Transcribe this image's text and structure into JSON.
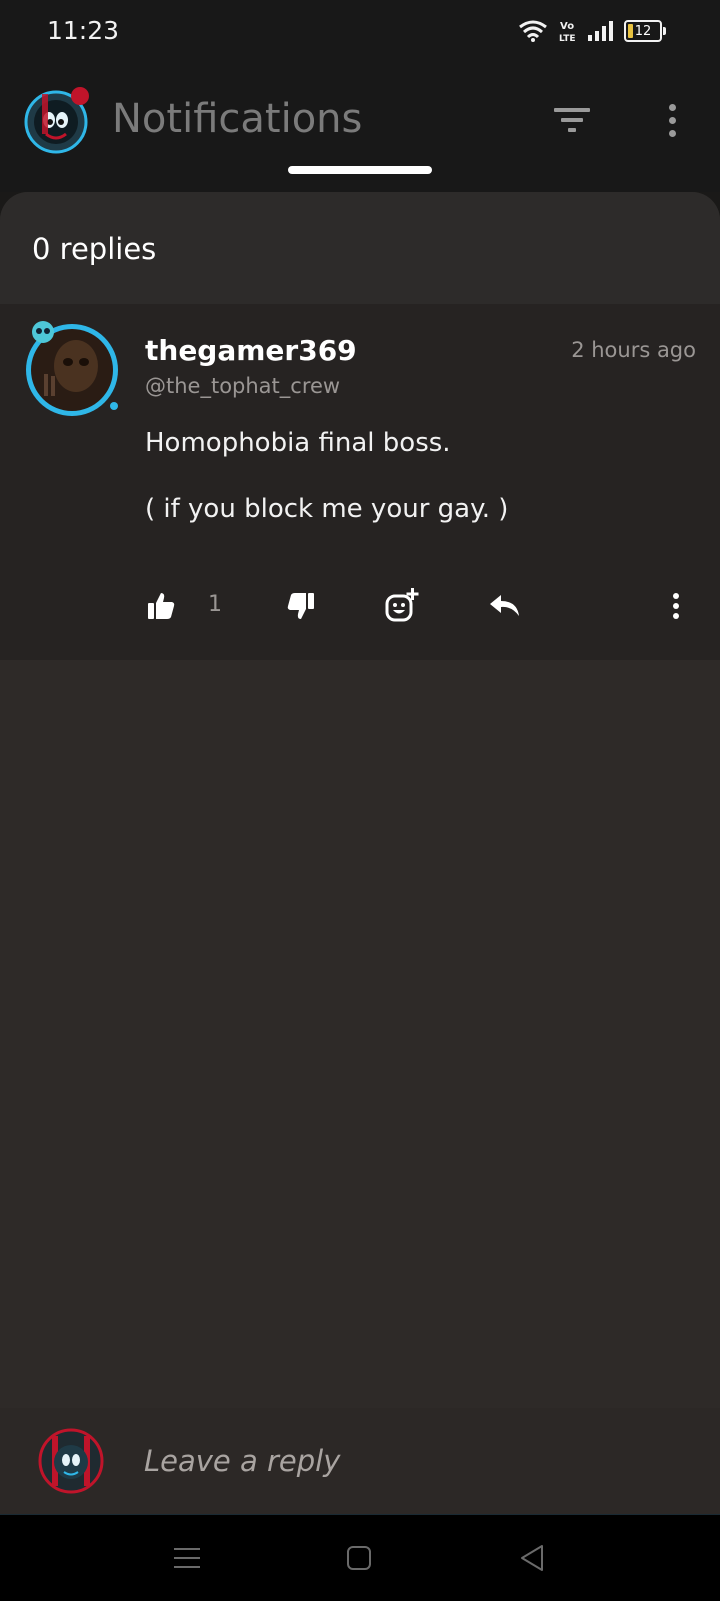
{
  "status_bar": {
    "time": "11:23",
    "battery_level": "12"
  },
  "app_bar": {
    "title": "Notifications"
  },
  "thread": {
    "replies_count": "0 replies"
  },
  "comment": {
    "username": "thegamer369",
    "handle": "@the_tophat_crew",
    "timestamp": "2 hours ago",
    "body": [
      "Homophobia final boss.",
      "( if you block me your gay. )"
    ],
    "like_count": "1"
  },
  "reply_box": {
    "placeholder": "Leave a reply"
  },
  "colors": {
    "accent_ring": "#2fb7e8",
    "logo_red": "#c0142a",
    "sheet_bg": "#2e2a28"
  }
}
